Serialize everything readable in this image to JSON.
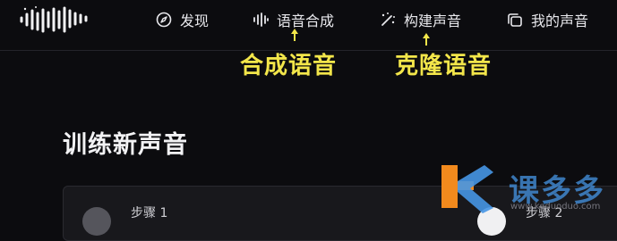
{
  "nav": {
    "items": [
      {
        "label": "发现",
        "icon": "compass-icon"
      },
      {
        "label": "语音合成",
        "icon": "waveform-icon"
      },
      {
        "label": "构建声音",
        "icon": "magic-wand-icon"
      },
      {
        "label": "我的声音",
        "icon": "library-icon"
      }
    ]
  },
  "annotations": {
    "synth": "合成语音",
    "clone": "克隆语音",
    "color": "#f3e64a"
  },
  "page": {
    "title": "训练新声音"
  },
  "steps": [
    {
      "label": "步骤 1"
    },
    {
      "label": "步骤 2"
    }
  ],
  "watermark": {
    "text": "课多多",
    "url": "www.keduoduo.com"
  }
}
